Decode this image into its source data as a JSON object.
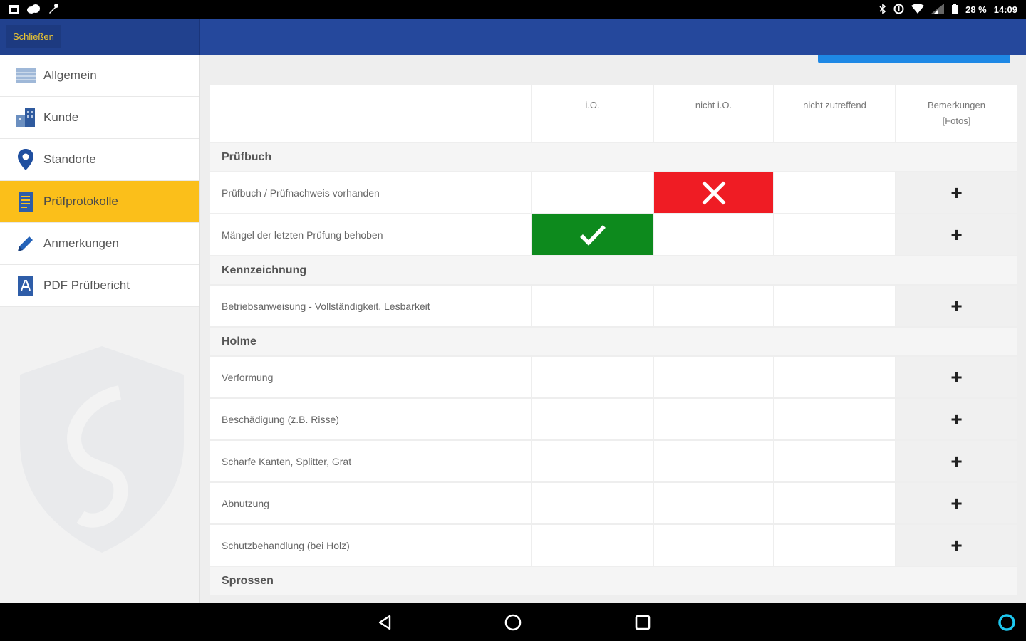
{
  "status_bar": {
    "battery": "28 %",
    "time": "14:09"
  },
  "app_bar": {
    "close_label": "Schließen"
  },
  "sidebar": {
    "items": [
      {
        "label": "Allgemein",
        "icon": "list-icon"
      },
      {
        "label": "Kunde",
        "icon": "building-icon"
      },
      {
        "label": "Standorte",
        "icon": "location-pin-icon"
      },
      {
        "label": "Prüfprotokolle",
        "icon": "document-icon",
        "active": true
      },
      {
        "label": "Anmerkungen",
        "icon": "pencil-icon"
      },
      {
        "label": "PDF Prüfbericht",
        "icon": "pdf-icon"
      }
    ]
  },
  "table": {
    "headers": {
      "io": "i.O.",
      "nio": "nicht i.O.",
      "nz": "nicht zutreffend",
      "rem_line1": "Bemerkungen",
      "rem_line2": "[Fotos]"
    },
    "sections": [
      {
        "title": "Prüfbuch"
      },
      {
        "title": "Kennzeichnung"
      },
      {
        "title": "Holme"
      },
      {
        "title": "Sprossen"
      }
    ],
    "rows": [
      {
        "label": "Prüfbuch / Prüfnachweis vorhanden",
        "status": "nio"
      },
      {
        "label": "Mängel der letzten Prüfung behoben",
        "status": "io"
      },
      {
        "label": "Betriebsanweisung - Vollständigkeit, Lesbarkeit",
        "status": ""
      },
      {
        "label": "Verformung",
        "status": ""
      },
      {
        "label": "Beschädigung (z.B. Risse)",
        "status": ""
      },
      {
        "label": "Scharfe Kanten, Splitter, Grat",
        "status": ""
      },
      {
        "label": "Abnutzung",
        "status": ""
      },
      {
        "label": "Schutzbehandlung (bei Holz)",
        "status": ""
      }
    ],
    "add_symbol": "+"
  },
  "colors": {
    "app_bar": "#25489c",
    "active_nav": "#fbbf1a",
    "io_green": "#0d8a1d",
    "nio_red": "#ef1c24",
    "accent_blue": "#1e88e5"
  }
}
